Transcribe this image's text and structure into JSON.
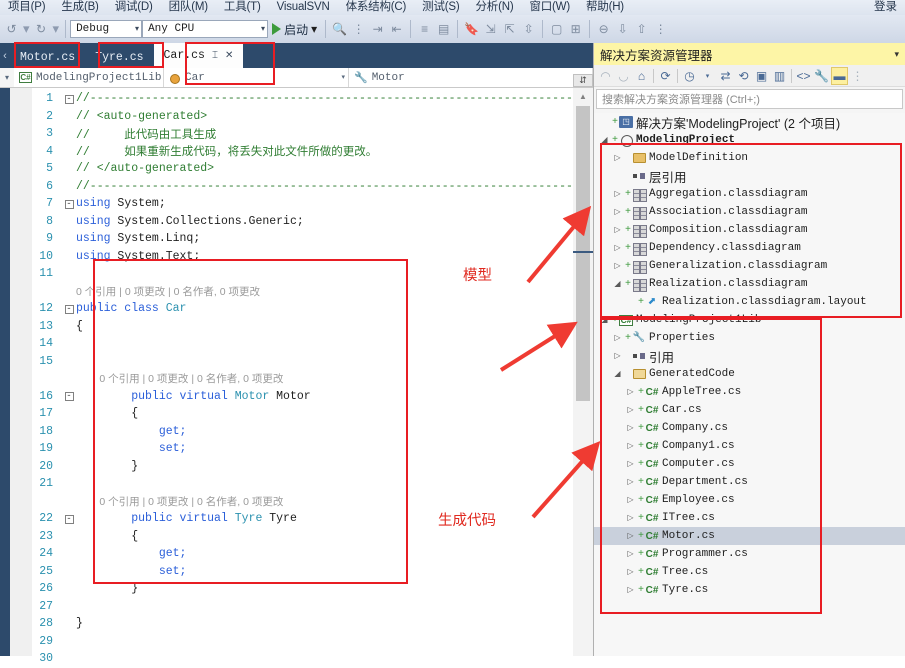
{
  "menubar": {
    "items": [
      "项目(P)",
      "生成(B)",
      "调试(D)",
      "团队(M)",
      "工具(T)",
      "VisualSVN",
      "体系结构(C)",
      "测试(S)",
      "分析(N)",
      "窗口(W)",
      "帮助(H)"
    ],
    "signin": "登录"
  },
  "toolbar": {
    "undo_caret": "▾",
    "redo_caret": "▾",
    "config": "Debug",
    "platform": "Any CPU",
    "run_label": "启动",
    "caret": "▾"
  },
  "tabs": [
    {
      "label": "Motor.cs",
      "active": false
    },
    {
      "label": "Tyre.cs",
      "active": false
    },
    {
      "label": "Car.cs",
      "active": true
    }
  ],
  "navbar": {
    "namespace": "ModelingProject1Lib",
    "type": "Car",
    "member": "Motor"
  },
  "editor": {
    "lines": [
      {
        "num": "1",
        "fold": "-",
        "indent": 0,
        "spans": [
          {
            "t": "//-----------------------------------------------------------------------",
            "c": "comment"
          }
        ]
      },
      {
        "num": "2",
        "fold": "",
        "indent": 0,
        "spans": [
          {
            "t": "// <auto-generated>",
            "c": "comment"
          }
        ]
      },
      {
        "num": "3",
        "fold": "",
        "indent": 0,
        "spans": [
          {
            "t": "//     此代码由工具生成",
            "c": "comment"
          }
        ]
      },
      {
        "num": "4",
        "fold": "",
        "indent": 0,
        "spans": [
          {
            "t": "//     如果重新生成代码，将丢失对此文件所做的更改。",
            "c": "comment"
          }
        ]
      },
      {
        "num": "5",
        "fold": "",
        "indent": 0,
        "spans": [
          {
            "t": "// </auto-generated>",
            "c": "comment"
          }
        ]
      },
      {
        "num": "6",
        "fold": "",
        "indent": 0,
        "spans": [
          {
            "t": "//-----------------------------------------------------------------------",
            "c": "comment"
          }
        ]
      },
      {
        "num": "7",
        "fold": "-",
        "indent": 0,
        "spans": [
          {
            "t": "using ",
            "c": "kw"
          },
          {
            "t": "System;",
            "c": "plain"
          }
        ]
      },
      {
        "num": "8",
        "fold": "",
        "indent": 0,
        "spans": [
          {
            "t": "using ",
            "c": "kw"
          },
          {
            "t": "System.Collections.Generic;",
            "c": "plain"
          }
        ]
      },
      {
        "num": "9",
        "fold": "",
        "indent": 0,
        "spans": [
          {
            "t": "using ",
            "c": "kw"
          },
          {
            "t": "System.Linq;",
            "c": "plain"
          }
        ]
      },
      {
        "num": "10",
        "fold": "",
        "indent": 0,
        "spans": [
          {
            "t": "using ",
            "c": "kw"
          },
          {
            "t": "System.Text;",
            "c": "plain"
          }
        ]
      },
      {
        "num": "11",
        "fold": "",
        "indent": 0,
        "spans": []
      },
      {
        "num": "",
        "fold": "",
        "indent": 0,
        "lens": "0 个引用 | 0 项更改 | 0 名作者, 0 项更改"
      },
      {
        "num": "12",
        "fold": "-",
        "indent": 0,
        "spans": [
          {
            "t": "public class ",
            "c": "kw"
          },
          {
            "t": "Car",
            "c": "type"
          }
        ]
      },
      {
        "num": "13",
        "fold": "",
        "indent": 0,
        "spans": [
          {
            "t": "{",
            "c": "plain"
          }
        ]
      },
      {
        "num": "14",
        "fold": "",
        "indent": 0,
        "spans": []
      },
      {
        "num": "15",
        "fold": "",
        "indent": 0,
        "spans": []
      },
      {
        "num": "",
        "fold": "",
        "indent": 2,
        "lens": "0 个引用 | 0 项更改 | 0 名作者, 0 项更改"
      },
      {
        "num": "16",
        "fold": "-",
        "indent": 2,
        "spans": [
          {
            "t": "public virtual ",
            "c": "kw"
          },
          {
            "t": "Motor ",
            "c": "type"
          },
          {
            "t": "Motor",
            "c": "plain"
          }
        ]
      },
      {
        "num": "17",
        "fold": "",
        "indent": 2,
        "spans": [
          {
            "t": "{",
            "c": "plain"
          }
        ]
      },
      {
        "num": "18",
        "fold": "",
        "indent": 3,
        "spans": [
          {
            "t": "get;",
            "c": "kw"
          }
        ]
      },
      {
        "num": "19",
        "fold": "",
        "indent": 3,
        "spans": [
          {
            "t": "set;",
            "c": "kw"
          }
        ]
      },
      {
        "num": "20",
        "fold": "",
        "indent": 2,
        "spans": [
          {
            "t": "}",
            "c": "plain"
          }
        ]
      },
      {
        "num": "21",
        "fold": "",
        "indent": 0,
        "spans": []
      },
      {
        "num": "",
        "fold": "",
        "indent": 2,
        "lens": "0 个引用 | 0 项更改 | 0 名作者, 0 项更改"
      },
      {
        "num": "22",
        "fold": "-",
        "indent": 2,
        "spans": [
          {
            "t": "public virtual ",
            "c": "kw"
          },
          {
            "t": "Tyre ",
            "c": "type"
          },
          {
            "t": "Tyre",
            "c": "plain"
          }
        ]
      },
      {
        "num": "23",
        "fold": "",
        "indent": 2,
        "spans": [
          {
            "t": "{",
            "c": "plain"
          }
        ]
      },
      {
        "num": "24",
        "fold": "",
        "indent": 3,
        "spans": [
          {
            "t": "get;",
            "c": "kw"
          }
        ]
      },
      {
        "num": "25",
        "fold": "",
        "indent": 3,
        "spans": [
          {
            "t": "set;",
            "c": "kw"
          }
        ]
      },
      {
        "num": "26",
        "fold": "",
        "indent": 2,
        "spans": [
          {
            "t": "}",
            "c": "plain"
          }
        ]
      },
      {
        "num": "27",
        "fold": "",
        "indent": 0,
        "spans": []
      },
      {
        "num": "28",
        "fold": "",
        "indent": 0,
        "spans": [
          {
            "t": "}",
            "c": "plain"
          }
        ]
      },
      {
        "num": "29",
        "fold": "",
        "indent": 0,
        "spans": []
      },
      {
        "num": "30",
        "fold": "",
        "indent": 0,
        "spans": []
      }
    ]
  },
  "solution_explorer": {
    "title": "解决方案资源管理器",
    "search_placeholder": "搜索解决方案资源管理器 (Ctrl+;)",
    "tree": [
      {
        "depth": 0,
        "exp": "",
        "plus": "+",
        "icon": "solution-icon",
        "label": "解决方案'ModelingProject' (2 个项目)",
        "cjk": true,
        "bold": false,
        "selected": false
      },
      {
        "depth": 0,
        "exp": "▲",
        "plus": "+",
        "icon": "project-icon",
        "label": "ModelingProject",
        "cjk": false,
        "bold": true,
        "selected": false
      },
      {
        "depth": 1,
        "exp": "▷",
        "plus": "",
        "icon": "folder-icon",
        "label": "ModelDefinition",
        "cjk": false,
        "bold": false,
        "selected": false
      },
      {
        "depth": 1,
        "exp": "",
        "plus": "",
        "icon": "references-icon",
        "label": "层引用",
        "cjk": true,
        "bold": false,
        "selected": false
      },
      {
        "depth": 1,
        "exp": "▷",
        "plus": "+",
        "icon": "classdiagram-icon",
        "label": "Aggregation.classdiagram",
        "cjk": false,
        "bold": false,
        "selected": false
      },
      {
        "depth": 1,
        "exp": "▷",
        "plus": "+",
        "icon": "classdiagram-icon",
        "label": "Association.classdiagram",
        "cjk": false,
        "bold": false,
        "selected": false
      },
      {
        "depth": 1,
        "exp": "▷",
        "plus": "+",
        "icon": "classdiagram-icon",
        "label": "Composition.classdiagram",
        "cjk": false,
        "bold": false,
        "selected": false
      },
      {
        "depth": 1,
        "exp": "▷",
        "plus": "+",
        "icon": "classdiagram-icon",
        "label": "Dependency.classdiagram",
        "cjk": false,
        "bold": false,
        "selected": false
      },
      {
        "depth": 1,
        "exp": "▷",
        "plus": "+",
        "icon": "classdiagram-icon",
        "label": "Generalization.classdiagram",
        "cjk": false,
        "bold": false,
        "selected": false
      },
      {
        "depth": 1,
        "exp": "▲",
        "plus": "+",
        "icon": "classdiagram-icon",
        "label": "Realization.classdiagram",
        "cjk": false,
        "bold": false,
        "selected": false
      },
      {
        "depth": 2,
        "exp": "",
        "plus": "+",
        "icon": "layout-icon",
        "label": "Realization.classdiagram.layout",
        "cjk": false,
        "bold": false,
        "selected": false
      },
      {
        "depth": 0,
        "exp": "▲",
        "plus": "+",
        "icon": "csproj-icon",
        "label": "ModelingProject1Lib",
        "cjk": false,
        "bold": false,
        "selected": false
      },
      {
        "depth": 1,
        "exp": "▷",
        "plus": "+",
        "icon": "wrench-icon",
        "label": "Properties",
        "cjk": false,
        "bold": false,
        "selected": false
      },
      {
        "depth": 1,
        "exp": "▷",
        "plus": "",
        "icon": "references-icon",
        "label": "引用",
        "cjk": true,
        "bold": false,
        "selected": false
      },
      {
        "depth": 1,
        "exp": "▲",
        "plus": "",
        "icon": "folder-open-icon",
        "label": "GeneratedCode",
        "cjk": false,
        "bold": false,
        "selected": false
      },
      {
        "depth": 2,
        "exp": "▷",
        "plus": "+",
        "icon": "cs-file-icon",
        "label": "AppleTree.cs",
        "cjk": false,
        "bold": false,
        "selected": false
      },
      {
        "depth": 2,
        "exp": "▷",
        "plus": "+",
        "icon": "cs-file-icon",
        "label": "Car.cs",
        "cjk": false,
        "bold": false,
        "selected": false
      },
      {
        "depth": 2,
        "exp": "▷",
        "plus": "+",
        "icon": "cs-file-icon",
        "label": "Company.cs",
        "cjk": false,
        "bold": false,
        "selected": false
      },
      {
        "depth": 2,
        "exp": "▷",
        "plus": "+",
        "icon": "cs-file-icon",
        "label": "Company1.cs",
        "cjk": false,
        "bold": false,
        "selected": false
      },
      {
        "depth": 2,
        "exp": "▷",
        "plus": "+",
        "icon": "cs-file-icon",
        "label": "Computer.cs",
        "cjk": false,
        "bold": false,
        "selected": false
      },
      {
        "depth": 2,
        "exp": "▷",
        "plus": "+",
        "icon": "cs-file-icon",
        "label": "Department.cs",
        "cjk": false,
        "bold": false,
        "selected": false
      },
      {
        "depth": 2,
        "exp": "▷",
        "plus": "+",
        "icon": "cs-file-icon",
        "label": "Employee.cs",
        "cjk": false,
        "bold": false,
        "selected": false
      },
      {
        "depth": 2,
        "exp": "▷",
        "plus": "+",
        "icon": "cs-file-icon",
        "label": "ITree.cs",
        "cjk": false,
        "bold": false,
        "selected": false
      },
      {
        "depth": 2,
        "exp": "▷",
        "plus": "+",
        "icon": "cs-file-icon",
        "label": "Motor.cs",
        "cjk": false,
        "bold": false,
        "selected": true
      },
      {
        "depth": 2,
        "exp": "▷",
        "plus": "+",
        "icon": "cs-file-icon",
        "label": "Programmer.cs",
        "cjk": false,
        "bold": false,
        "selected": false
      },
      {
        "depth": 2,
        "exp": "▷",
        "plus": "+",
        "icon": "cs-file-icon",
        "label": "Tree.cs",
        "cjk": false,
        "bold": false,
        "selected": false
      },
      {
        "depth": 2,
        "exp": "▷",
        "plus": "+",
        "icon": "cs-file-icon",
        "label": "Tyre.cs",
        "cjk": false,
        "bold": false,
        "selected": false
      }
    ]
  },
  "annotations": {
    "model_label": "模型",
    "generated_code_label": "生成代码",
    "highlight_color": "#e81d23"
  }
}
